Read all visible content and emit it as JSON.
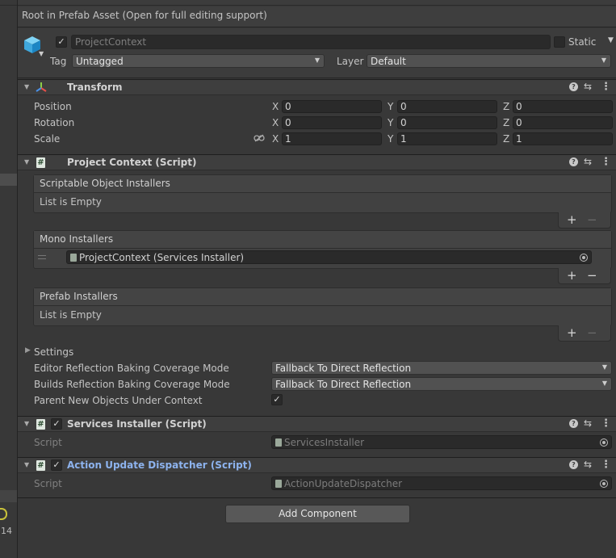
{
  "banner": "Root in Prefab Asset (Open for full editing support)",
  "game_object": {
    "name": "ProjectContext",
    "active_checked": true,
    "static_label": "Static",
    "tag_label": "Tag",
    "tag_value": "Untagged",
    "layer_label": "Layer",
    "layer_value": "Default"
  },
  "transform": {
    "title": "Transform",
    "rows": [
      {
        "label": "Position",
        "x": "0",
        "y": "0",
        "z": "0"
      },
      {
        "label": "Rotation",
        "x": "0",
        "y": "0",
        "z": "0"
      },
      {
        "label": "Scale",
        "x": "1",
        "y": "1",
        "z": "1"
      }
    ],
    "axis_x": "X",
    "axis_y": "Y",
    "axis_z": "Z"
  },
  "project_context": {
    "title": "Project Context (Script)",
    "scriptable_installers_header": "Scriptable Object Installers",
    "scriptable_installers_empty": "List is Empty",
    "mono_installers_header": "Mono Installers",
    "mono_installer_item": "ProjectContext (Services Installer)",
    "prefab_installers_header": "Prefab Installers",
    "prefab_installers_empty": "List is Empty",
    "settings_label": "Settings",
    "editor_reflection_label": "Editor Reflection Baking Coverage Mode",
    "editor_reflection_value": "Fallback To Direct Reflection",
    "builds_reflection_label": "Builds Reflection Baking Coverage Mode",
    "builds_reflection_value": "Fallback To Direct Reflection",
    "parent_new_objects_label": "Parent New Objects Under Context",
    "parent_new_objects_checked": true
  },
  "services_installer": {
    "title": "Services Installer (Script)",
    "script_label": "Script",
    "script_value": "ServicesInstaller"
  },
  "action_update_dispatcher": {
    "title": "Action Update Dispatcher (Script)",
    "script_label": "Script",
    "script_value": "ActionUpdateDispatcher",
    "title_color": "#8db3ee"
  },
  "add_component": "Add Component",
  "left_panel": {
    "number": "14"
  },
  "colors": {
    "background": "#383838",
    "field": "#2a2a2a",
    "header": "#3e3e3e"
  }
}
